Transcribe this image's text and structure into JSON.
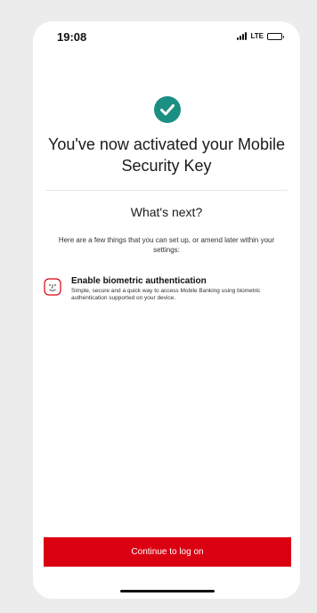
{
  "status_bar": {
    "time": "19:08",
    "network": "LTE",
    "icons": [
      "signal-icon",
      "battery-icon"
    ]
  },
  "success": {
    "icon": "check-circle-icon",
    "color": "#1a8f82"
  },
  "heading": "You've now activated your Mobile Security Key",
  "next_section": {
    "title": "What's next?",
    "intro": "Here are a few things that you can set up, or amend later within your settings:"
  },
  "options": [
    {
      "icon": "face-id-icon",
      "title": "Enable biometric authentication",
      "description": "Simple, secure and a quick way to access Mobile Banking using biometric authentication supported on your device."
    }
  ],
  "actions": {
    "continue_label": "Continue to log on",
    "continue_color": "#db0011"
  }
}
